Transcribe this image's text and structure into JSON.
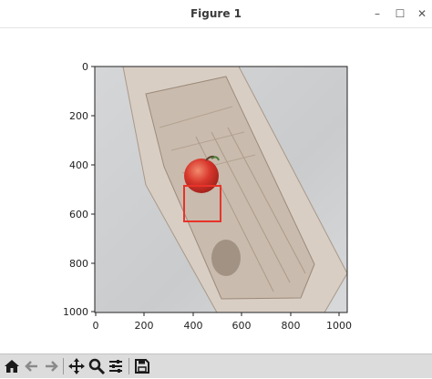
{
  "window": {
    "title": "Figure 1",
    "controls": {
      "minimize": "–",
      "maximize": "☐",
      "close": "✕"
    }
  },
  "plot": {
    "xaxis_ticks": [
      "0",
      "200",
      "400",
      "600",
      "800",
      "1000"
    ],
    "yaxis_ticks": [
      "0",
      "200",
      "400",
      "600",
      "800",
      "1000"
    ],
    "image_content": "wooden crate with a red apple",
    "bounding_box_color": "#e8332a"
  },
  "toolbar": {
    "buttons": [
      "home-icon",
      "back-icon",
      "forward-icon",
      "pan-icon",
      "zoom-icon",
      "configure-icon",
      "save-icon"
    ]
  },
  "colors": {
    "toolbar_bg": "#dcdcdc",
    "window_bg": "#ffffff",
    "box": "#e8332a"
  }
}
